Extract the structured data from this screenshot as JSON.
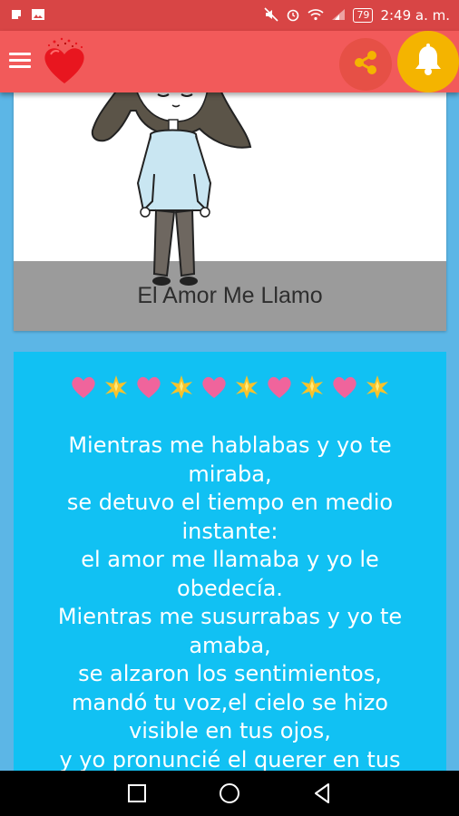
{
  "status_bar": {
    "time": "2:49 a. m.",
    "battery": "79",
    "icons": [
      "notification-icon",
      "gallery-icon",
      "mute-icon",
      "alarm-icon",
      "wifi-icon",
      "signal-icon"
    ]
  },
  "app_bar": {
    "menu_icon": "hamburger-menu-icon",
    "logo_icon": "glitter-heart-icon",
    "share_icon": "share-icon",
    "bell_icon": "bell-icon",
    "colors": {
      "status": "#d84545",
      "app_bar": "#f25a5a",
      "bell": "#f4b400"
    }
  },
  "card_top": {
    "caption": "El Amor Me Llamo"
  },
  "card_poem": {
    "emoji_row": [
      "pink-heart",
      "sparkle",
      "pink-heart",
      "sparkle",
      "pink-heart",
      "sparkle",
      "pink-heart",
      "sparkle",
      "pink-heart",
      "sparkle"
    ],
    "text": "Mientras me hablabas y yo te\nmiraba,\nse detuvo el tiempo en medio\ninstante:\nel amor me llamaba y yo le\nobedecía.\nMientras me susurrabas y yo te\namaba,\nse alzaron los sentimientos,\nmandó tu voz,el cielo se hizo\nvisible en tus ojos,\ny yo pronuncié el querer en tus",
    "background": "#11c1f3"
  },
  "nav_bar": {
    "recent": "recent-apps-icon",
    "home": "home-icon",
    "back": "back-icon"
  }
}
